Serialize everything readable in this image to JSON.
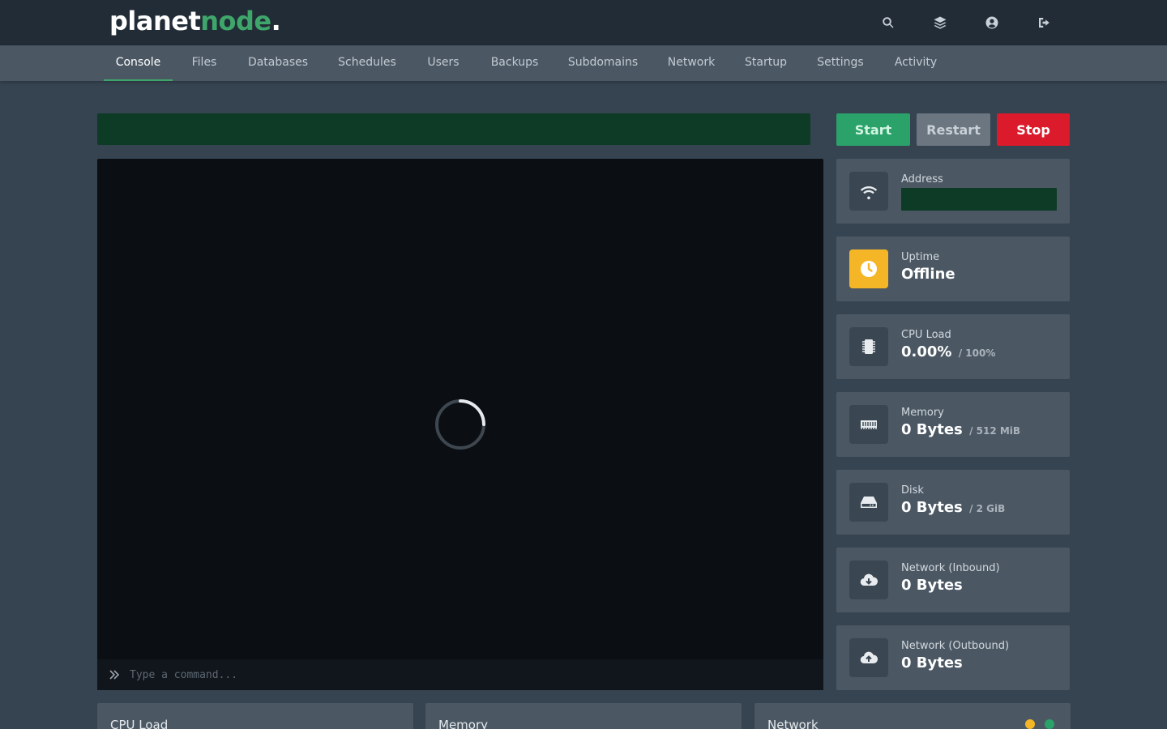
{
  "brand": {
    "part1": "planet",
    "part2": "node",
    "dot": "."
  },
  "topbar": {
    "icons": [
      "search-icon",
      "layers-icon",
      "user-circle-icon",
      "sign-out-icon"
    ]
  },
  "nav": {
    "items": [
      {
        "label": "Console",
        "active": true
      },
      {
        "label": "Files"
      },
      {
        "label": "Databases"
      },
      {
        "label": "Schedules"
      },
      {
        "label": "Users"
      },
      {
        "label": "Backups"
      },
      {
        "label": "Subdomains"
      },
      {
        "label": "Network"
      },
      {
        "label": "Startup"
      },
      {
        "label": "Settings"
      },
      {
        "label": "Activity"
      }
    ]
  },
  "power": {
    "start": "Start",
    "restart": "Restart",
    "stop": "Stop"
  },
  "console": {
    "placeholder": "Type a command..."
  },
  "stats": {
    "address": {
      "label": "Address",
      "value": ""
    },
    "uptime": {
      "label": "Uptime",
      "value": "Offline"
    },
    "cpu": {
      "label": "CPU Load",
      "value": "0.00%",
      "limit": "/ 100%"
    },
    "memory": {
      "label": "Memory",
      "value": "0 Bytes",
      "limit": "/ 512 MiB"
    },
    "disk": {
      "label": "Disk",
      "value": "0 Bytes",
      "limit": "/ 2 GiB"
    },
    "net_in": {
      "label": "Network (Inbound)",
      "value": "0 Bytes"
    },
    "net_out": {
      "label": "Network (Outbound)",
      "value": "0 Bytes"
    }
  },
  "graphs": {
    "cpu": "CPU Load",
    "memory": "Memory",
    "network": "Network"
  },
  "colors": {
    "accent": "#3ea66b",
    "start": "#2aa26a",
    "restart": "#6b7681",
    "stop": "#db1b2b",
    "uptime_icon": "#f4b627"
  }
}
